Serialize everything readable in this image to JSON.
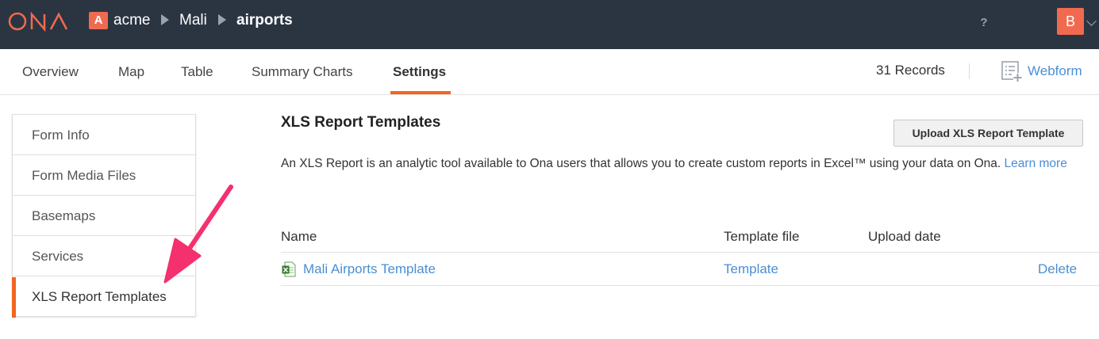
{
  "header": {
    "logo_text": "ONA",
    "org_badge": "A",
    "breadcrumb": [
      "acme",
      "Mali",
      "airports"
    ],
    "help_label": "?",
    "user_initial": "B"
  },
  "tabs": {
    "items": [
      "Overview",
      "Map",
      "Table",
      "Summary Charts",
      "Settings"
    ],
    "active": "Settings",
    "records_label": "31 Records",
    "webform_label": "Webform"
  },
  "sidebar": {
    "items": [
      "Form Info",
      "Form Media Files",
      "Basemaps",
      "Services",
      "XLS Report Templates"
    ],
    "active": "XLS Report Templates"
  },
  "main": {
    "title": "XLS Report Templates",
    "upload_button": "Upload XLS Report Template",
    "description": "An XLS Report is an analytic tool available to Ona users that allows you to create custom reports in Excel™ using your data on Ona.",
    "learn_more_label": "Learn more",
    "table": {
      "headers": [
        "Name",
        "Template file",
        "Upload date"
      ],
      "rows": [
        {
          "name": "Mali Airports Template",
          "template_file": "Template",
          "upload_date": "",
          "action": "Delete"
        }
      ]
    }
  },
  "colors": {
    "topbar_bg": "#2b3542",
    "accent": "#f26522",
    "badge": "#f06a50",
    "link": "#4a8fd4",
    "annotation_arrow": "#f5306e"
  },
  "icons": {
    "logo": "ona-logo",
    "breadcrumb_separator": "triangle-right-icon",
    "user_menu": "chevron-down-icon",
    "webform": "webform-icon",
    "file": "excel-file-icon",
    "annotation": "pointer-arrow-icon"
  }
}
